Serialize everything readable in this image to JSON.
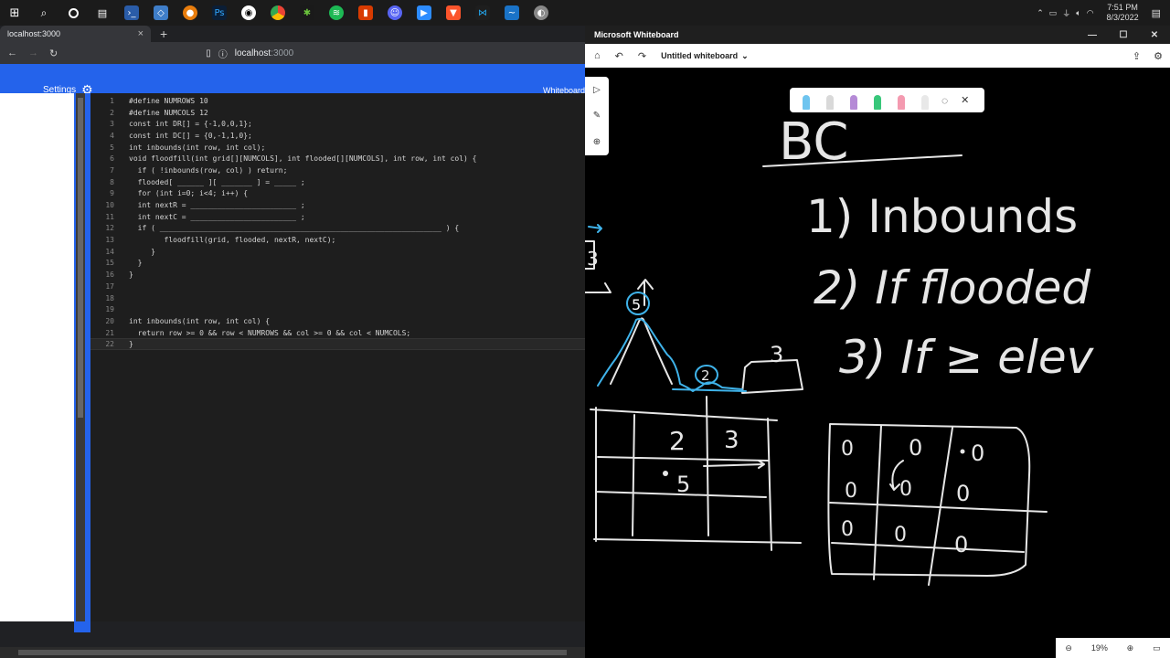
{
  "taskbar": {
    "icons": [
      "windows-start",
      "search",
      "cortana",
      "task-view",
      "powershell",
      "azure-data-studio",
      "blender",
      "photoshop",
      "github-desktop",
      "chrome",
      "fiddler",
      "spotify",
      "office",
      "discord",
      "zoom",
      "brave",
      "vscode",
      "whiteboard",
      "browser-app"
    ],
    "clock_time": "7:51 PM",
    "clock_date": "8/3/2022"
  },
  "browser": {
    "tab_title": "localhost:3000",
    "url_host": "localhost",
    "url_port": ":3000",
    "settings_label": "Settings",
    "whiteboard_label": "Whiteboard"
  },
  "editor": {
    "lines": [
      {
        "n": "1",
        "text": "#define NUMROWS 10"
      },
      {
        "n": "2",
        "text": "#define NUMCOLS 12"
      },
      {
        "n": "3",
        "text": "const int DR[] = {-1,0,0,1};"
      },
      {
        "n": "4",
        "text": "const int DC[] = {0,-1,1,0};"
      },
      {
        "n": "5",
        "text": "int inbounds(int row, int col);"
      },
      {
        "n": "6",
        "text": "void floodfill(int grid[][NUMCOLS], int flooded[][NUMCOLS], int row, int col) {"
      },
      {
        "n": "7",
        "text": "  if ( !inbounds(row, col) ) return;"
      },
      {
        "n": "8",
        "text": "  flooded[ ______ ][ _______ ] = _____ ;"
      },
      {
        "n": "9",
        "text": "  for (int i=0; i<4; i++) {"
      },
      {
        "n": "10",
        "text": "  int nextR = ________________________ ;"
      },
      {
        "n": "11",
        "text": "  int nextC = ________________________ ;"
      },
      {
        "n": "12",
        "text": "  if ( ________________________________________________________________ ) {"
      },
      {
        "n": "13",
        "text": "        floodfill(grid, flooded, nextR, nextC);"
      },
      {
        "n": "14",
        "text": "     }"
      },
      {
        "n": "15",
        "text": "  }"
      },
      {
        "n": "16",
        "text": "}"
      },
      {
        "n": "17",
        "text": ""
      },
      {
        "n": "18",
        "text": ""
      },
      {
        "n": "19",
        "text": ""
      },
      {
        "n": "20",
        "text": "int inbounds(int row, int col) {"
      },
      {
        "n": "21",
        "text": "  return row >= 0 && row < NUMROWS && col >= 0 && col < NUMCOLS;"
      },
      {
        "n": "22",
        "text": "}"
      }
    ],
    "current_line": "22"
  },
  "whiteboard": {
    "app_title": "Microsoft Whiteboard",
    "board_name": "Untitled whiteboard",
    "zoom": "19%",
    "ink_text": {
      "heading": "BC",
      "step1": "1) Inbounds",
      "step2": "2) If flooded",
      "step3": "3) If ≥ elev",
      "peak": "5",
      "valley": "2",
      "plateau": "3",
      "edge": "3",
      "grid1": [
        "2",
        "3",
        "5"
      ],
      "grid2": [
        "0",
        "0",
        "0",
        "0",
        "0",
        "0",
        "0",
        "0",
        "0"
      ]
    },
    "pen_colors": [
      "#6ec4ef",
      "#d9d9d9",
      "#b58ad6",
      "#38c77a",
      "#f49ab0",
      "#e8e8e8"
    ]
  }
}
